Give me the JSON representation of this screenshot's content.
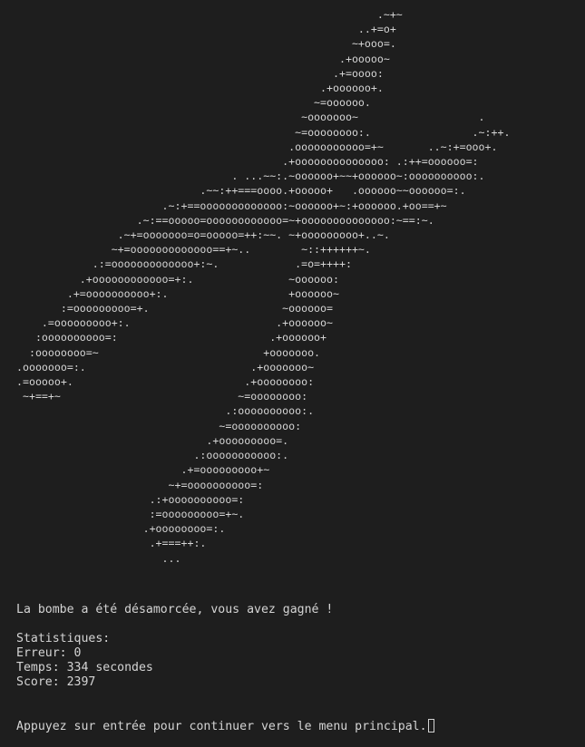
{
  "terminal": {
    "background": "#1e1e1e",
    "foreground": "#d4d4d4",
    "ascii_art": "                                                         .~+~\n                                                      ..+=o+\n                                                     ~+ooo=.\n                                                   .+ooooo~\n                                                  .+=oooo:\n                                                .+oooooo+.\n                                               ~=oooooo.\n                                             ~ooooooo~                   .\n                                            ~=oooooooo:.                .~:++.\n                                           .ooooooooooo=+~       ..~:+=ooo+.\n                                          .+oooooooooooooo: .:++=oooooo=:\n                                  . ...~~:.~oooooo+~~+oooooo~:oooooooooo:.\n                             .~~:++===oooo.+ooooo+   .oooooo~~oooooo=:.\n                       .~:+==ooooooooooooo:~oooooo+~:+oooooo.+oo==+~\n                   .~:==ooooo=oooooooooooo=~+oooooooooooooo:~==:~.\n                .~+=ooooooo=o=ooooo=++:~~. ~+ooooooooo+..~.\n               ~+=ooooooooooooo==+~..        ~::++++++~.\n            .:=ooooooooooooo+:~.            .=o=++++:\n          .+oooooooooooo=+:.               ~oooooo:\n        .+=oooooooooo+:.                   +oooooo~\n       :=ooooooooo=+.                     ~oooooo=\n    .=ooooooooo+:.                       .+oooooo~\n   :oooooooooo=:                        .+oooooo+\n  :oooooooo=~                          +ooooooo.\n.ooooooo=:.                          .+ooooooo~\n.=ooooo+.                           .+oooooooo:\n ~+==+~                            ~=oooooooo:\n                                 .:oooooooooo:.\n                                ~=oooooooooo:\n                              .+ooooooooo=.\n                            .:ooooooooooo:.\n                          .+=ooooooooo+~\n                        ~+=oooooooooo=:\n                     .:+oooooooooo=:\n                     :=ooooooooo=+~.\n                    .+oooooooo=:.\n                     .+===++:.\n                       ...",
    "result_message": "La bombe a été désamorcée, vous avez gagné !",
    "stats_title": "Statistiques:",
    "errors_line": "Erreur: 0",
    "time_line": "Temps: 334 secondes",
    "score_line": "Score: 2397",
    "prompt": "Appuyez sur entrée pour continuer vers le menu principal."
  }
}
